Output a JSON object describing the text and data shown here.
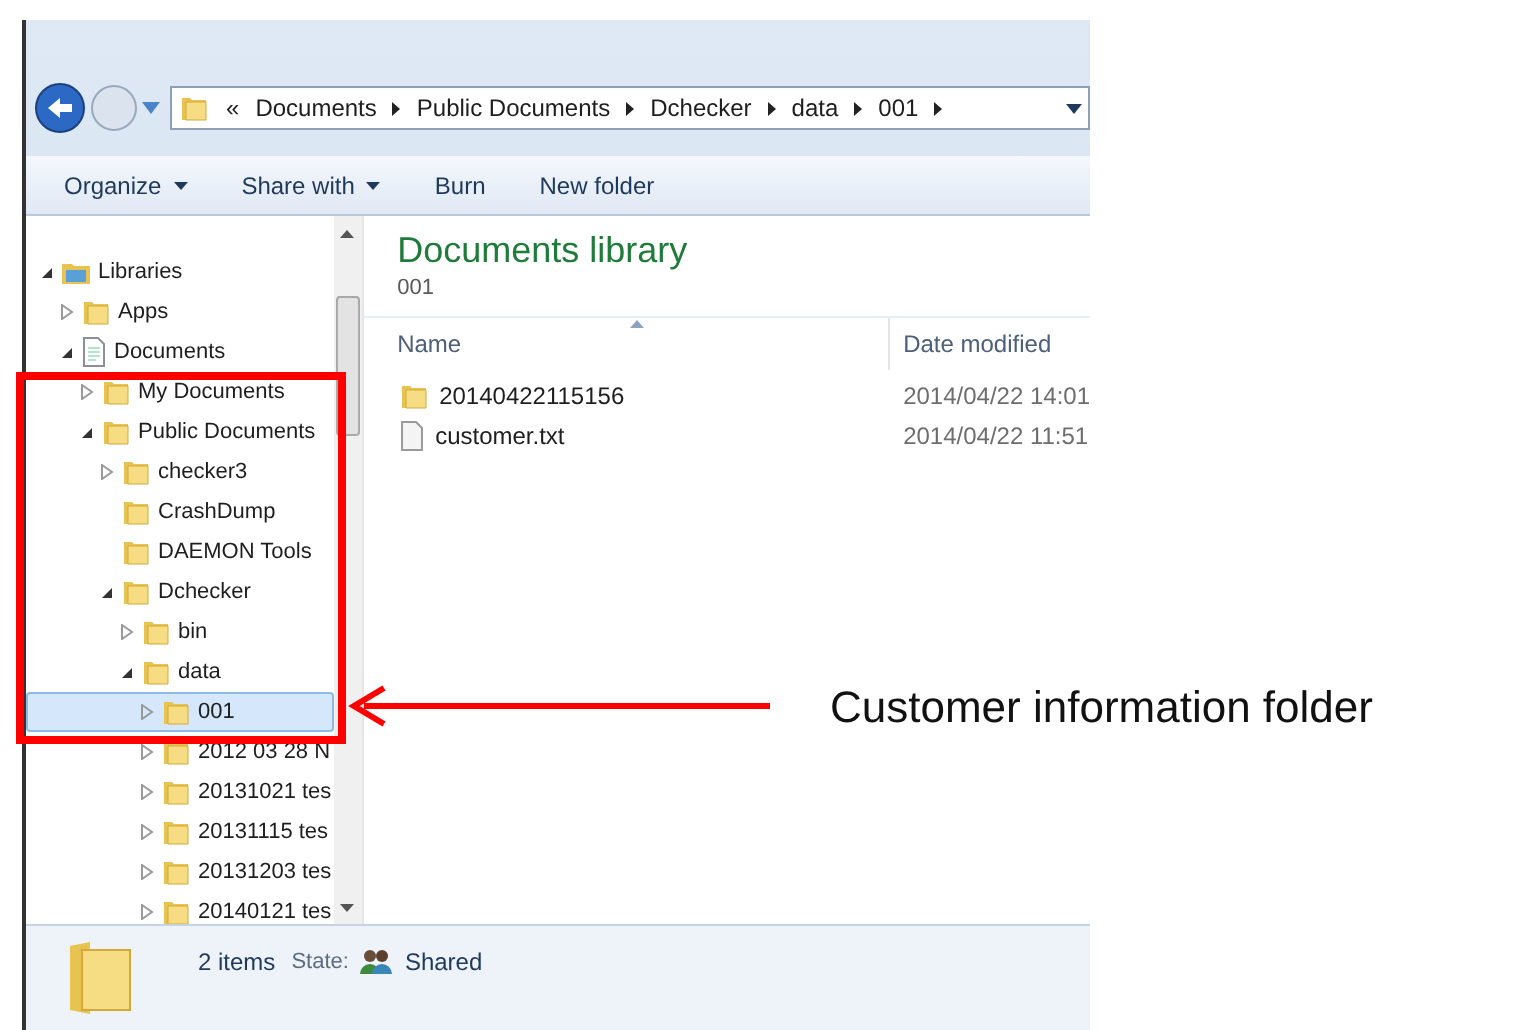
{
  "address_bar": {
    "overflow": "«",
    "crumbs": [
      "Documents",
      "Public Documents",
      "Dchecker",
      "data",
      "001"
    ]
  },
  "toolbar": [
    {
      "label": "Organize",
      "dropdown": true
    },
    {
      "label": "Share with",
      "dropdown": true
    },
    {
      "label": "Burn",
      "dropdown": false
    },
    {
      "label": "New folder",
      "dropdown": false
    }
  ],
  "tree": [
    {
      "label": "Libraries",
      "kind": "library",
      "expandable": true,
      "expanded": true,
      "selected": false,
      "children": [
        {
          "label": "Apps",
          "kind": "folder",
          "expandable": true,
          "expanded": false,
          "selected": false
        },
        {
          "label": "Documents",
          "kind": "document",
          "expandable": true,
          "expanded": true,
          "selected": false,
          "children": [
            {
              "label": "My Documents",
              "kind": "folder",
              "expandable": true,
              "expanded": false,
              "selected": false
            },
            {
              "label": "Public Documents",
              "kind": "folder",
              "expandable": true,
              "expanded": true,
              "selected": false,
              "children": [
                {
                  "label": "checker3",
                  "kind": "folder",
                  "expandable": true,
                  "expanded": false,
                  "selected": false
                },
                {
                  "label": "CrashDump",
                  "kind": "folder",
                  "expandable": false,
                  "selected": false
                },
                {
                  "label": "DAEMON Tools",
                  "kind": "folder",
                  "expandable": false,
                  "selected": false
                },
                {
                  "label": "Dchecker",
                  "kind": "folder",
                  "expandable": true,
                  "expanded": true,
                  "selected": false,
                  "children": [
                    {
                      "label": "bin",
                      "kind": "folder",
                      "expandable": true,
                      "expanded": false,
                      "selected": false
                    },
                    {
                      "label": "data",
                      "kind": "folder",
                      "expandable": true,
                      "expanded": true,
                      "selected": false,
                      "children": [
                        {
                          "label": "001",
                          "kind": "folder",
                          "expandable": true,
                          "expanded": false,
                          "selected": true
                        },
                        {
                          "label": "2012 03 28 N",
                          "kind": "folder",
                          "expandable": true,
                          "expanded": false,
                          "selected": false
                        },
                        {
                          "label": "20131021 tes",
                          "kind": "folder",
                          "expandable": true,
                          "expanded": false,
                          "selected": false
                        },
                        {
                          "label": "20131115 tes",
                          "kind": "folder",
                          "expandable": true,
                          "expanded": false,
                          "selected": false
                        },
                        {
                          "label": "20131203 tes",
                          "kind": "folder",
                          "expandable": true,
                          "expanded": false,
                          "selected": false
                        },
                        {
                          "label": "20140121 tes",
                          "kind": "folder",
                          "expandable": true,
                          "expanded": false,
                          "selected": false
                        }
                      ]
                    }
                  ]
                }
              ]
            }
          ]
        }
      ]
    }
  ],
  "content": {
    "title": "Documents library",
    "subtitle": "001",
    "columns": [
      "Name",
      "Date modified"
    ],
    "rows": [
      {
        "kind": "folder",
        "name": "20140422115156",
        "date": "2014/04/22 14:01"
      },
      {
        "kind": "file",
        "name": "customer.txt",
        "date": "2014/04/22 11:51"
      }
    ]
  },
  "status_bar": {
    "count": "2 items",
    "state_label": "State:",
    "state": "Shared"
  },
  "annotation": {
    "label": "Customer information folder"
  }
}
